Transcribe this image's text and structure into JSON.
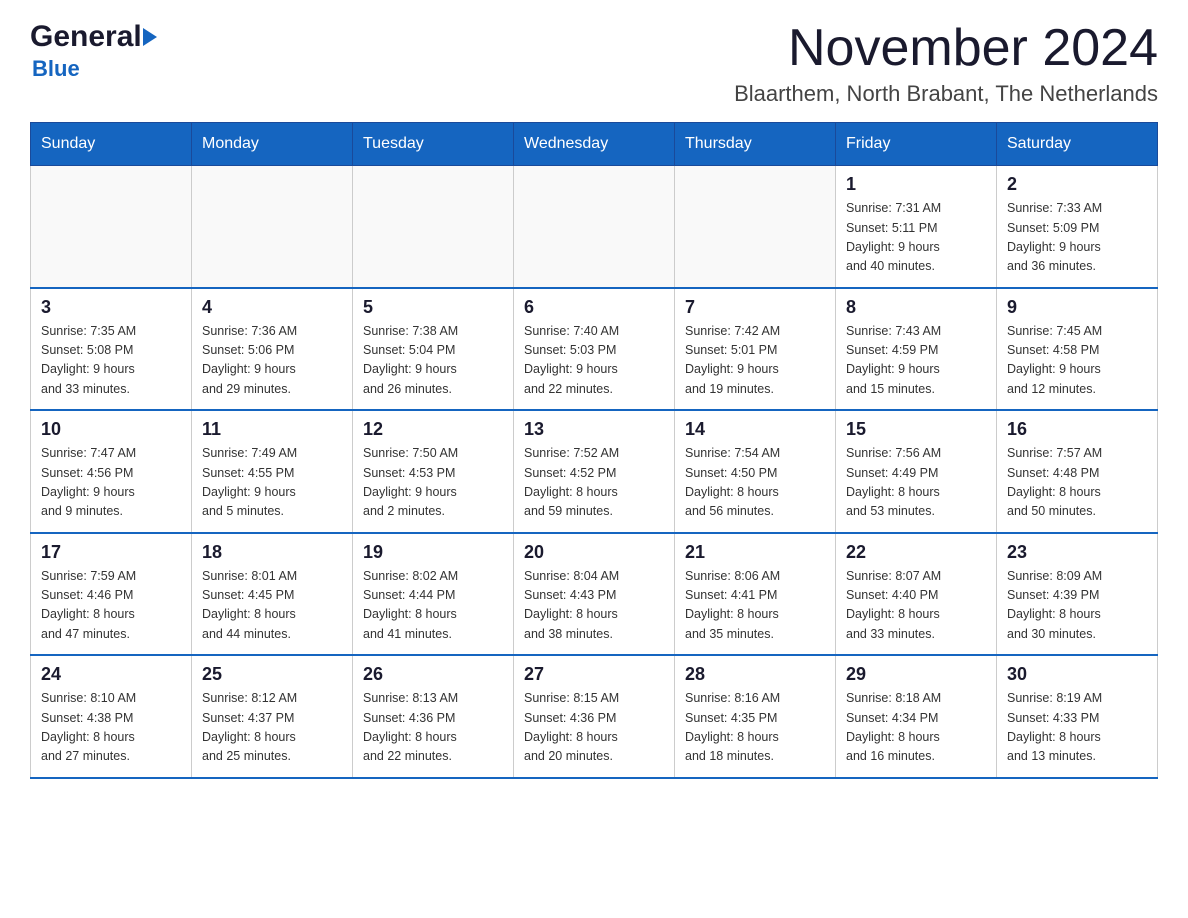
{
  "header": {
    "logo_general": "General",
    "logo_blue": "Blue",
    "title": "November 2024",
    "subtitle": "Blaarthem, North Brabant, The Netherlands"
  },
  "calendar": {
    "days_of_week": [
      "Sunday",
      "Monday",
      "Tuesday",
      "Wednesday",
      "Thursday",
      "Friday",
      "Saturday"
    ],
    "weeks": [
      [
        {
          "day": "",
          "info": ""
        },
        {
          "day": "",
          "info": ""
        },
        {
          "day": "",
          "info": ""
        },
        {
          "day": "",
          "info": ""
        },
        {
          "day": "",
          "info": ""
        },
        {
          "day": "1",
          "info": "Sunrise: 7:31 AM\nSunset: 5:11 PM\nDaylight: 9 hours\nand 40 minutes."
        },
        {
          "day": "2",
          "info": "Sunrise: 7:33 AM\nSunset: 5:09 PM\nDaylight: 9 hours\nand 36 minutes."
        }
      ],
      [
        {
          "day": "3",
          "info": "Sunrise: 7:35 AM\nSunset: 5:08 PM\nDaylight: 9 hours\nand 33 minutes."
        },
        {
          "day": "4",
          "info": "Sunrise: 7:36 AM\nSunset: 5:06 PM\nDaylight: 9 hours\nand 29 minutes."
        },
        {
          "day": "5",
          "info": "Sunrise: 7:38 AM\nSunset: 5:04 PM\nDaylight: 9 hours\nand 26 minutes."
        },
        {
          "day": "6",
          "info": "Sunrise: 7:40 AM\nSunset: 5:03 PM\nDaylight: 9 hours\nand 22 minutes."
        },
        {
          "day": "7",
          "info": "Sunrise: 7:42 AM\nSunset: 5:01 PM\nDaylight: 9 hours\nand 19 minutes."
        },
        {
          "day": "8",
          "info": "Sunrise: 7:43 AM\nSunset: 4:59 PM\nDaylight: 9 hours\nand 15 minutes."
        },
        {
          "day": "9",
          "info": "Sunrise: 7:45 AM\nSunset: 4:58 PM\nDaylight: 9 hours\nand 12 minutes."
        }
      ],
      [
        {
          "day": "10",
          "info": "Sunrise: 7:47 AM\nSunset: 4:56 PM\nDaylight: 9 hours\nand 9 minutes."
        },
        {
          "day": "11",
          "info": "Sunrise: 7:49 AM\nSunset: 4:55 PM\nDaylight: 9 hours\nand 5 minutes."
        },
        {
          "day": "12",
          "info": "Sunrise: 7:50 AM\nSunset: 4:53 PM\nDaylight: 9 hours\nand 2 minutes."
        },
        {
          "day": "13",
          "info": "Sunrise: 7:52 AM\nSunset: 4:52 PM\nDaylight: 8 hours\nand 59 minutes."
        },
        {
          "day": "14",
          "info": "Sunrise: 7:54 AM\nSunset: 4:50 PM\nDaylight: 8 hours\nand 56 minutes."
        },
        {
          "day": "15",
          "info": "Sunrise: 7:56 AM\nSunset: 4:49 PM\nDaylight: 8 hours\nand 53 minutes."
        },
        {
          "day": "16",
          "info": "Sunrise: 7:57 AM\nSunset: 4:48 PM\nDaylight: 8 hours\nand 50 minutes."
        }
      ],
      [
        {
          "day": "17",
          "info": "Sunrise: 7:59 AM\nSunset: 4:46 PM\nDaylight: 8 hours\nand 47 minutes."
        },
        {
          "day": "18",
          "info": "Sunrise: 8:01 AM\nSunset: 4:45 PM\nDaylight: 8 hours\nand 44 minutes."
        },
        {
          "day": "19",
          "info": "Sunrise: 8:02 AM\nSunset: 4:44 PM\nDaylight: 8 hours\nand 41 minutes."
        },
        {
          "day": "20",
          "info": "Sunrise: 8:04 AM\nSunset: 4:43 PM\nDaylight: 8 hours\nand 38 minutes."
        },
        {
          "day": "21",
          "info": "Sunrise: 8:06 AM\nSunset: 4:41 PM\nDaylight: 8 hours\nand 35 minutes."
        },
        {
          "day": "22",
          "info": "Sunrise: 8:07 AM\nSunset: 4:40 PM\nDaylight: 8 hours\nand 33 minutes."
        },
        {
          "day": "23",
          "info": "Sunrise: 8:09 AM\nSunset: 4:39 PM\nDaylight: 8 hours\nand 30 minutes."
        }
      ],
      [
        {
          "day": "24",
          "info": "Sunrise: 8:10 AM\nSunset: 4:38 PM\nDaylight: 8 hours\nand 27 minutes."
        },
        {
          "day": "25",
          "info": "Sunrise: 8:12 AM\nSunset: 4:37 PM\nDaylight: 8 hours\nand 25 minutes."
        },
        {
          "day": "26",
          "info": "Sunrise: 8:13 AM\nSunset: 4:36 PM\nDaylight: 8 hours\nand 22 minutes."
        },
        {
          "day": "27",
          "info": "Sunrise: 8:15 AM\nSunset: 4:36 PM\nDaylight: 8 hours\nand 20 minutes."
        },
        {
          "day": "28",
          "info": "Sunrise: 8:16 AM\nSunset: 4:35 PM\nDaylight: 8 hours\nand 18 minutes."
        },
        {
          "day": "29",
          "info": "Sunrise: 8:18 AM\nSunset: 4:34 PM\nDaylight: 8 hours\nand 16 minutes."
        },
        {
          "day": "30",
          "info": "Sunrise: 8:19 AM\nSunset: 4:33 PM\nDaylight: 8 hours\nand 13 minutes."
        }
      ]
    ]
  }
}
